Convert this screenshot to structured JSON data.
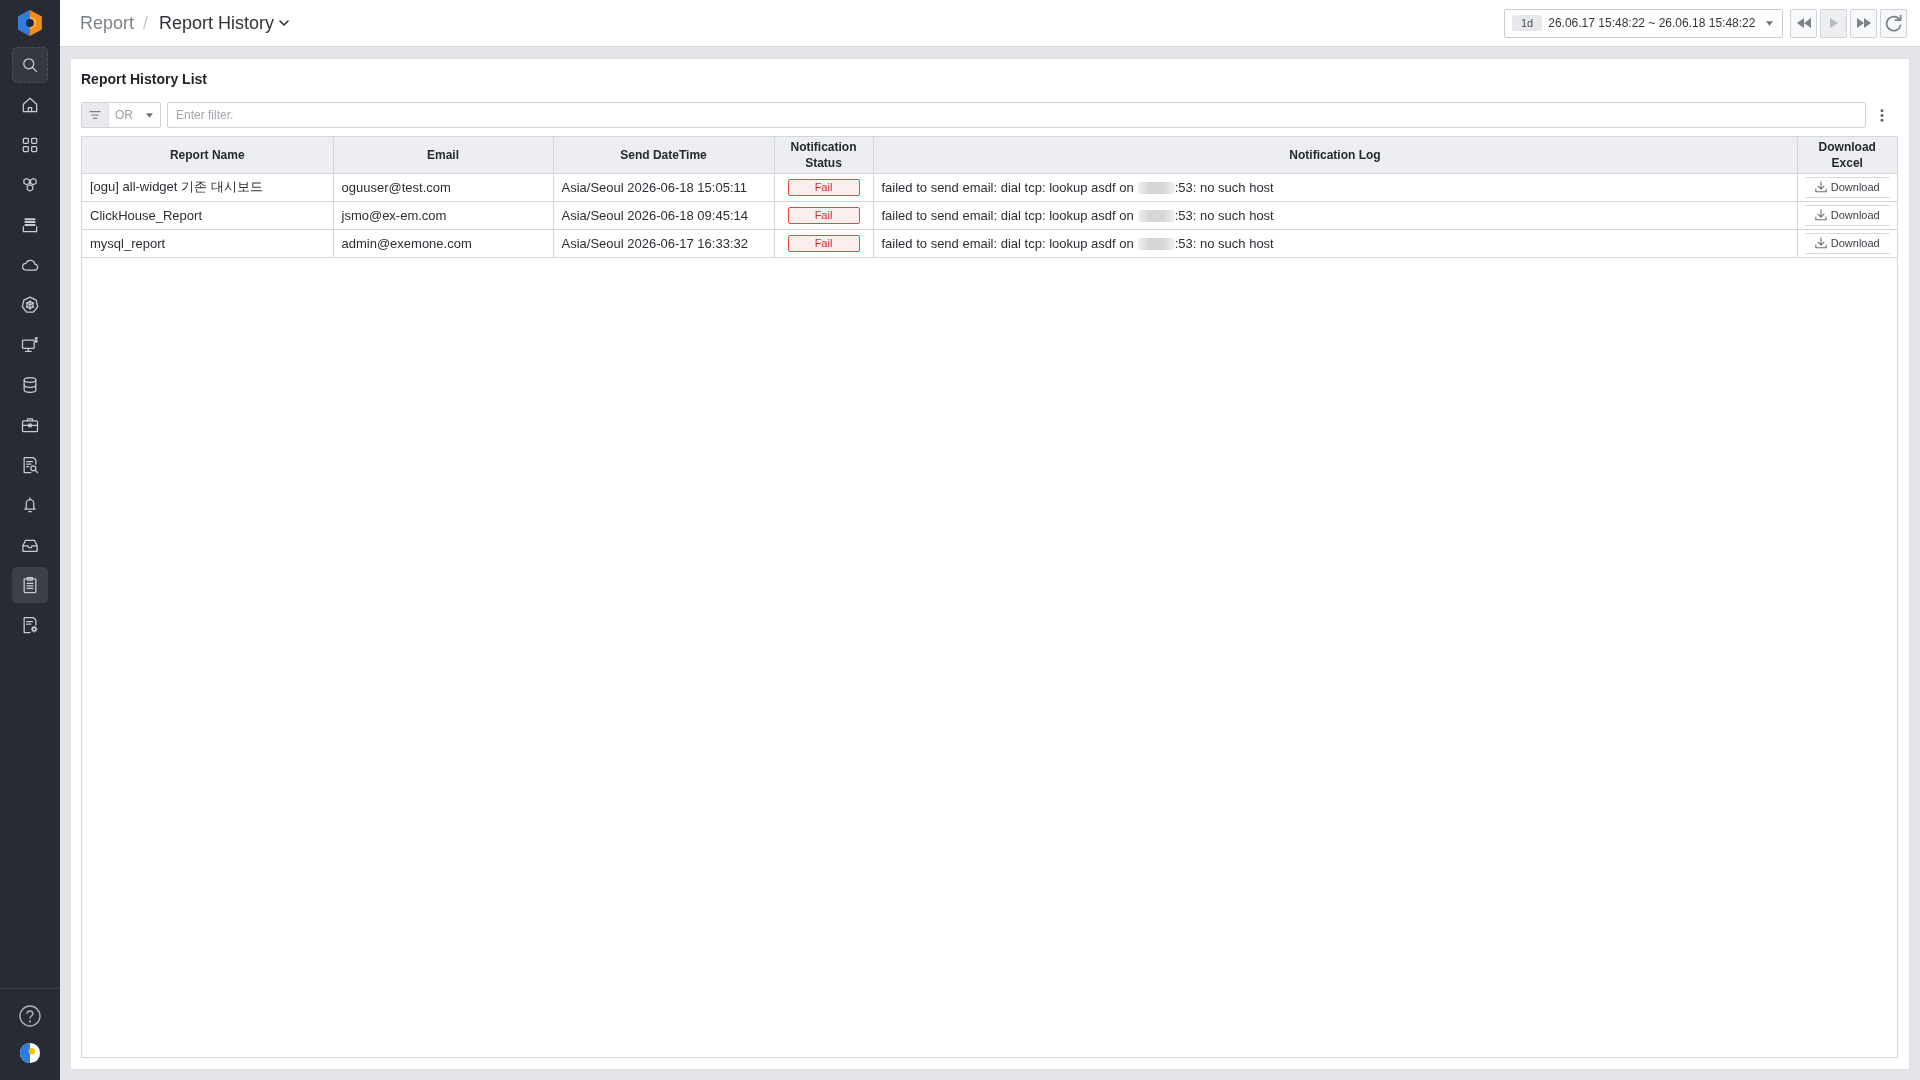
{
  "sidebar": {
    "items": [
      {
        "selected": false
      },
      {
        "selected": false
      },
      {
        "selected": false
      },
      {
        "selected": false
      },
      {
        "selected": false
      },
      {
        "selected": false
      },
      {
        "selected": false
      },
      {
        "selected": false
      },
      {
        "selected": false
      },
      {
        "selected": false
      },
      {
        "selected": false
      },
      {
        "selected": false
      },
      {
        "selected": true
      },
      {
        "selected": false
      }
    ]
  },
  "breadcrumb": {
    "parent": "Report",
    "separator": "/",
    "current": "Report History"
  },
  "time_range": {
    "preset": "1d",
    "range": "26.06.17 15:48:22 ~ 26.06.18 15:48:22"
  },
  "playback_buttons": [
    {
      "disabled": false
    },
    {
      "disabled": true
    },
    {
      "disabled": false
    }
  ],
  "card": {
    "title": "Report History List"
  },
  "filter": {
    "operator": "OR",
    "placeholder": "Enter filter."
  },
  "table": {
    "columns": [
      "Report Name",
      "Email",
      "Send DateTime",
      "Notification Status",
      "Notification Log",
      "Download Excel"
    ],
    "rows": [
      {
        "report_name": "[ogu] all-widget 기존 대시보드",
        "email": "oguuser@test.com",
        "send_datetime": "Asia/Seoul 2026-06-18 15:05:11",
        "status": "Fail",
        "log_start": "failed to send email: dial tcp: lookup asdf on",
        "redacted": true,
        "log_end": ":53: no such host",
        "download": "Download"
      },
      {
        "report_name": "ClickHouse_Report",
        "email": "jsmo@ex-em.com",
        "send_datetime": "Asia/Seoul 2026-06-18 09:45:14",
        "status": "Fail",
        "log_start": "failed to send email: dial tcp: lookup asdf on",
        "redacted": true,
        "log_end": ":53: no such host",
        "download": "Download"
      },
      {
        "report_name": "mysql_report",
        "email": "admin@exemone.com",
        "send_datetime": "Asia/Seoul 2026-06-17 16:33:32",
        "status": "Fail",
        "log_start": "failed to send email: dial tcp: lookup asdf on",
        "redacted": true,
        "log_end": ":53: no such host",
        "download": "Download"
      }
    ]
  }
}
